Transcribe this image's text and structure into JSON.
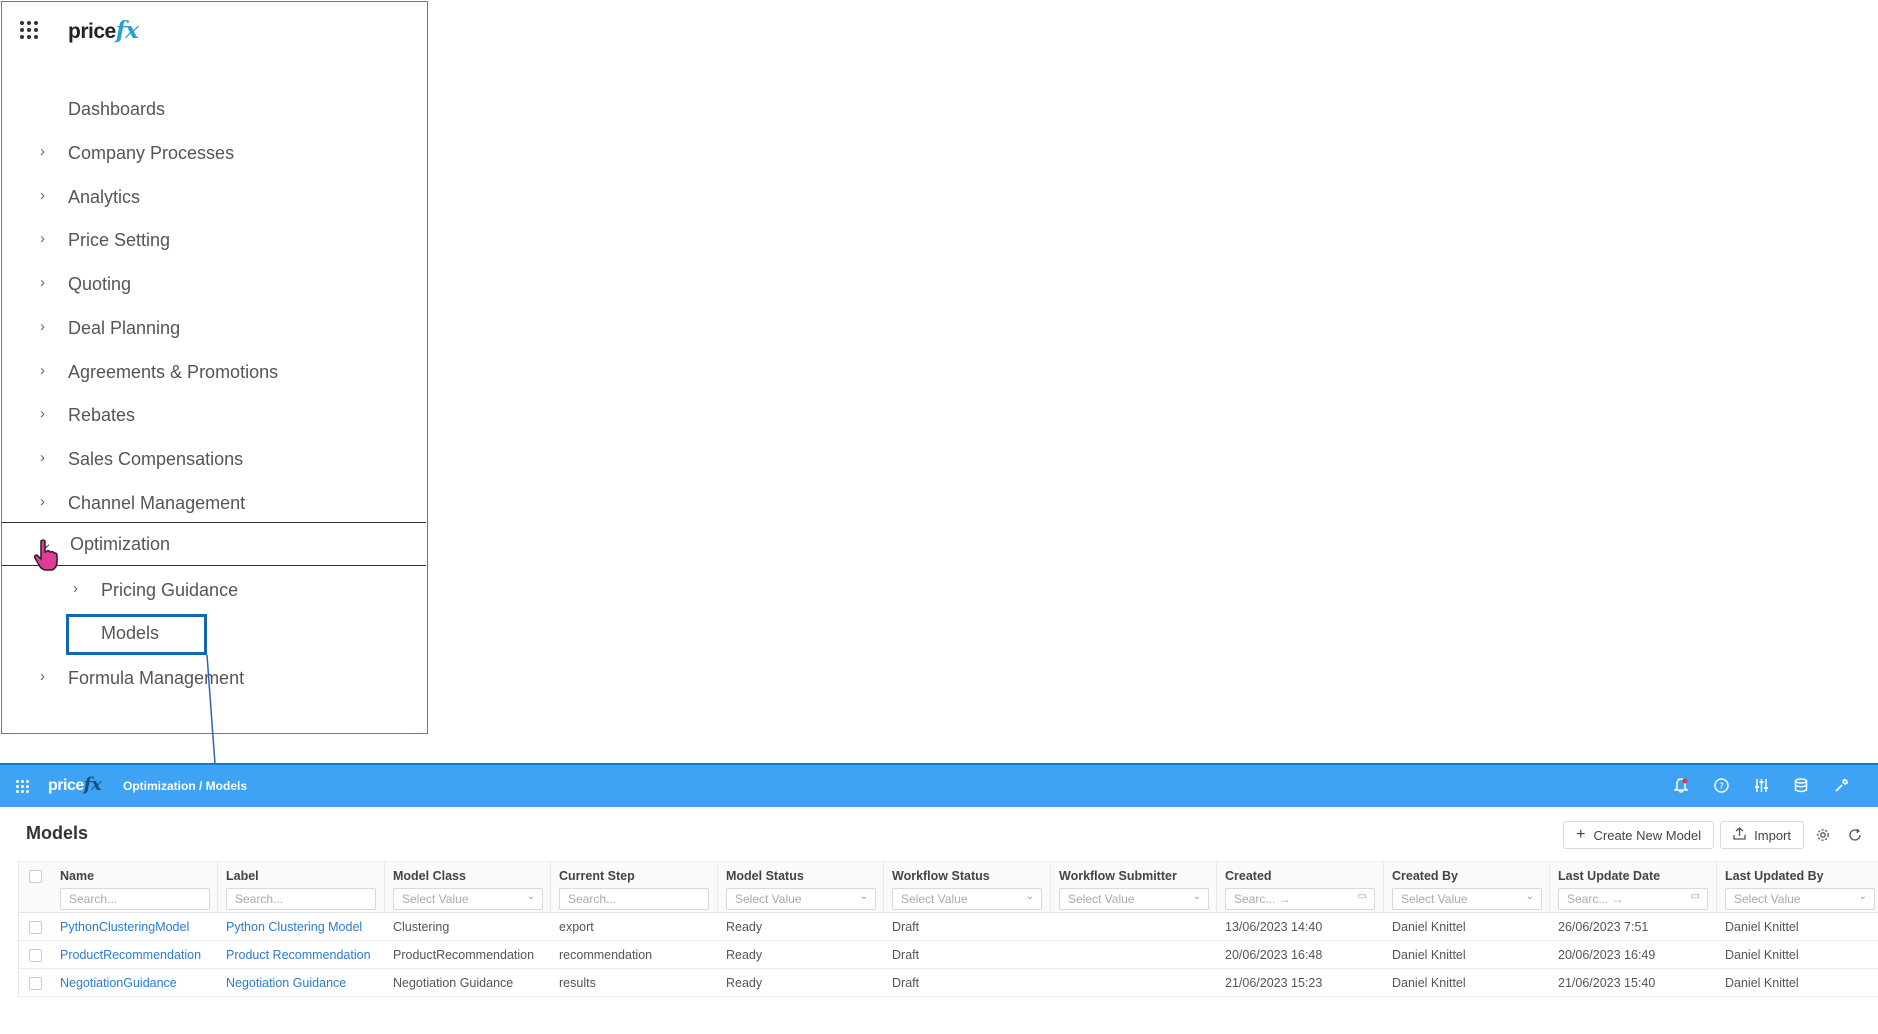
{
  "nav": {
    "logo_text": "price",
    "logo_accent": "fx",
    "items": [
      {
        "label": "Dashboards",
        "chevron": false
      },
      {
        "label": "Company Processes",
        "chevron": true
      },
      {
        "label": "Analytics",
        "chevron": true
      },
      {
        "label": "Price Setting",
        "chevron": true
      },
      {
        "label": "Quoting",
        "chevron": true
      },
      {
        "label": "Deal Planning",
        "chevron": true
      },
      {
        "label": "Agreements & Promotions",
        "chevron": true
      },
      {
        "label": "Rebates",
        "chevron": true
      },
      {
        "label": "Sales Compensations",
        "chevron": true
      },
      {
        "label": "Channel Management",
        "chevron": true
      },
      {
        "label": "Optimization",
        "chevron": true,
        "expanded": true
      },
      {
        "label": "Pricing Guidance",
        "chevron": true,
        "sub": true
      },
      {
        "label": "Models",
        "chevron": false,
        "sub": true,
        "highlighted": true
      },
      {
        "label": "Formula Management",
        "chevron": true
      }
    ]
  },
  "app": {
    "logo_text": "price",
    "logo_accent": "fx",
    "breadcrumb": "Optimization / Models",
    "page_title": "Models",
    "toolbar": {
      "create_label": "Create New Model",
      "import_label": "Import"
    },
    "columns": [
      {
        "title": "Name",
        "filter": "Search..."
      },
      {
        "title": "Label",
        "filter": "Search..."
      },
      {
        "title": "Model Class",
        "filter": "Select Value"
      },
      {
        "title": "Current Step",
        "filter": "Search..."
      },
      {
        "title": "Model Status",
        "filter": "Select Value"
      },
      {
        "title": "Workflow Status",
        "filter": "Select Value"
      },
      {
        "title": "Workflow Submitter",
        "filter": "Select Value"
      },
      {
        "title": "Created",
        "filter": "Searc... →"
      },
      {
        "title": "Created By",
        "filter": "Select Value"
      },
      {
        "title": "Last Update Date",
        "filter": "Searc... →"
      },
      {
        "title": "Last Updated By",
        "filter": "Select Value"
      }
    ],
    "rows": [
      [
        "PythonClusteringModel",
        "Python Clustering Model",
        "Clustering",
        "export",
        "Ready",
        "Draft",
        "",
        "13/06/2023 14:40",
        "Daniel Knittel",
        "26/06/2023 7:51",
        "Daniel Knittel"
      ],
      [
        "ProductRecommendation",
        "Product Recommendation",
        "ProductRecommendation",
        "recommendation",
        "Ready",
        "Draft",
        "",
        "20/06/2023 16:48",
        "Daniel Knittel",
        "20/06/2023 16:49",
        "Daniel Knittel"
      ],
      [
        "NegotiationGuidance",
        "Negotiation Guidance",
        "Negotiation Guidance",
        "results",
        "Ready",
        "Draft",
        "",
        "21/06/2023 15:23",
        "Daniel Knittel",
        "21/06/2023 15:40",
        "Daniel Knittel"
      ]
    ]
  },
  "colors": {
    "accent": "#3ea3f5",
    "highlight_border": "#1167b5",
    "link": "#2a7ccf"
  }
}
